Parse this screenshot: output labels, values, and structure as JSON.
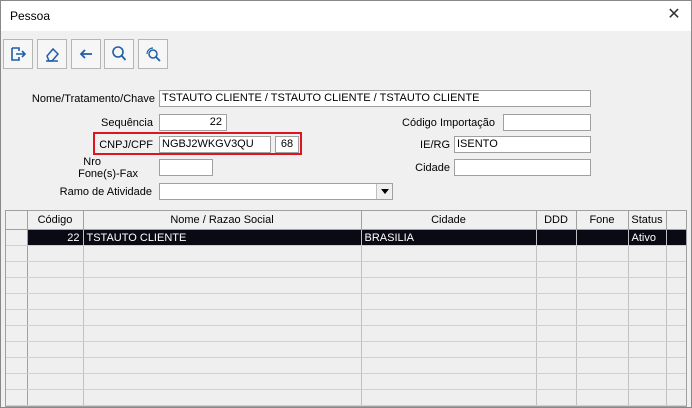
{
  "window": {
    "title": "Pessoa"
  },
  "toolbar": {
    "buttons": [
      "exit-icon",
      "eraser-icon",
      "back-arrow-icon",
      "search-icon",
      "advanced-search-icon"
    ]
  },
  "form": {
    "nome_label": "Nome/Tratamento/Chave",
    "nome_value": "TSTAUTO CLIENTE / TSTAUTO CLIENTE / TSTAUTO CLIENTE",
    "sequencia_label": "Sequência",
    "sequencia_value": "22",
    "codigo_importacao_label": "Código Importação",
    "codigo_importacao_value": "",
    "cnpj_label": "CNPJ/CPF",
    "cnpj_value": "NGBJ2WKGV3QU",
    "cnpj_suffix": "68",
    "ierg_label": "IE/RG",
    "ierg_value": "ISENTO",
    "nro_label": "Nro",
    "fone_label": "Fone(s)-Fax",
    "fone_value": "",
    "cidade_label": "Cidade",
    "cidade_value": "",
    "ramo_label": "Ramo de Atividade",
    "ramo_value": ""
  },
  "grid": {
    "columns": [
      "Código",
      "Nome / Razao Social",
      "Cidade",
      "DDD",
      "Fone",
      "Status"
    ],
    "rows": [
      {
        "codigo": "22",
        "nome": "TSTAUTO CLIENTE",
        "cidade": "BRASILIA",
        "ddd": "",
        "fone": "",
        "status": "Ativo"
      }
    ]
  }
}
